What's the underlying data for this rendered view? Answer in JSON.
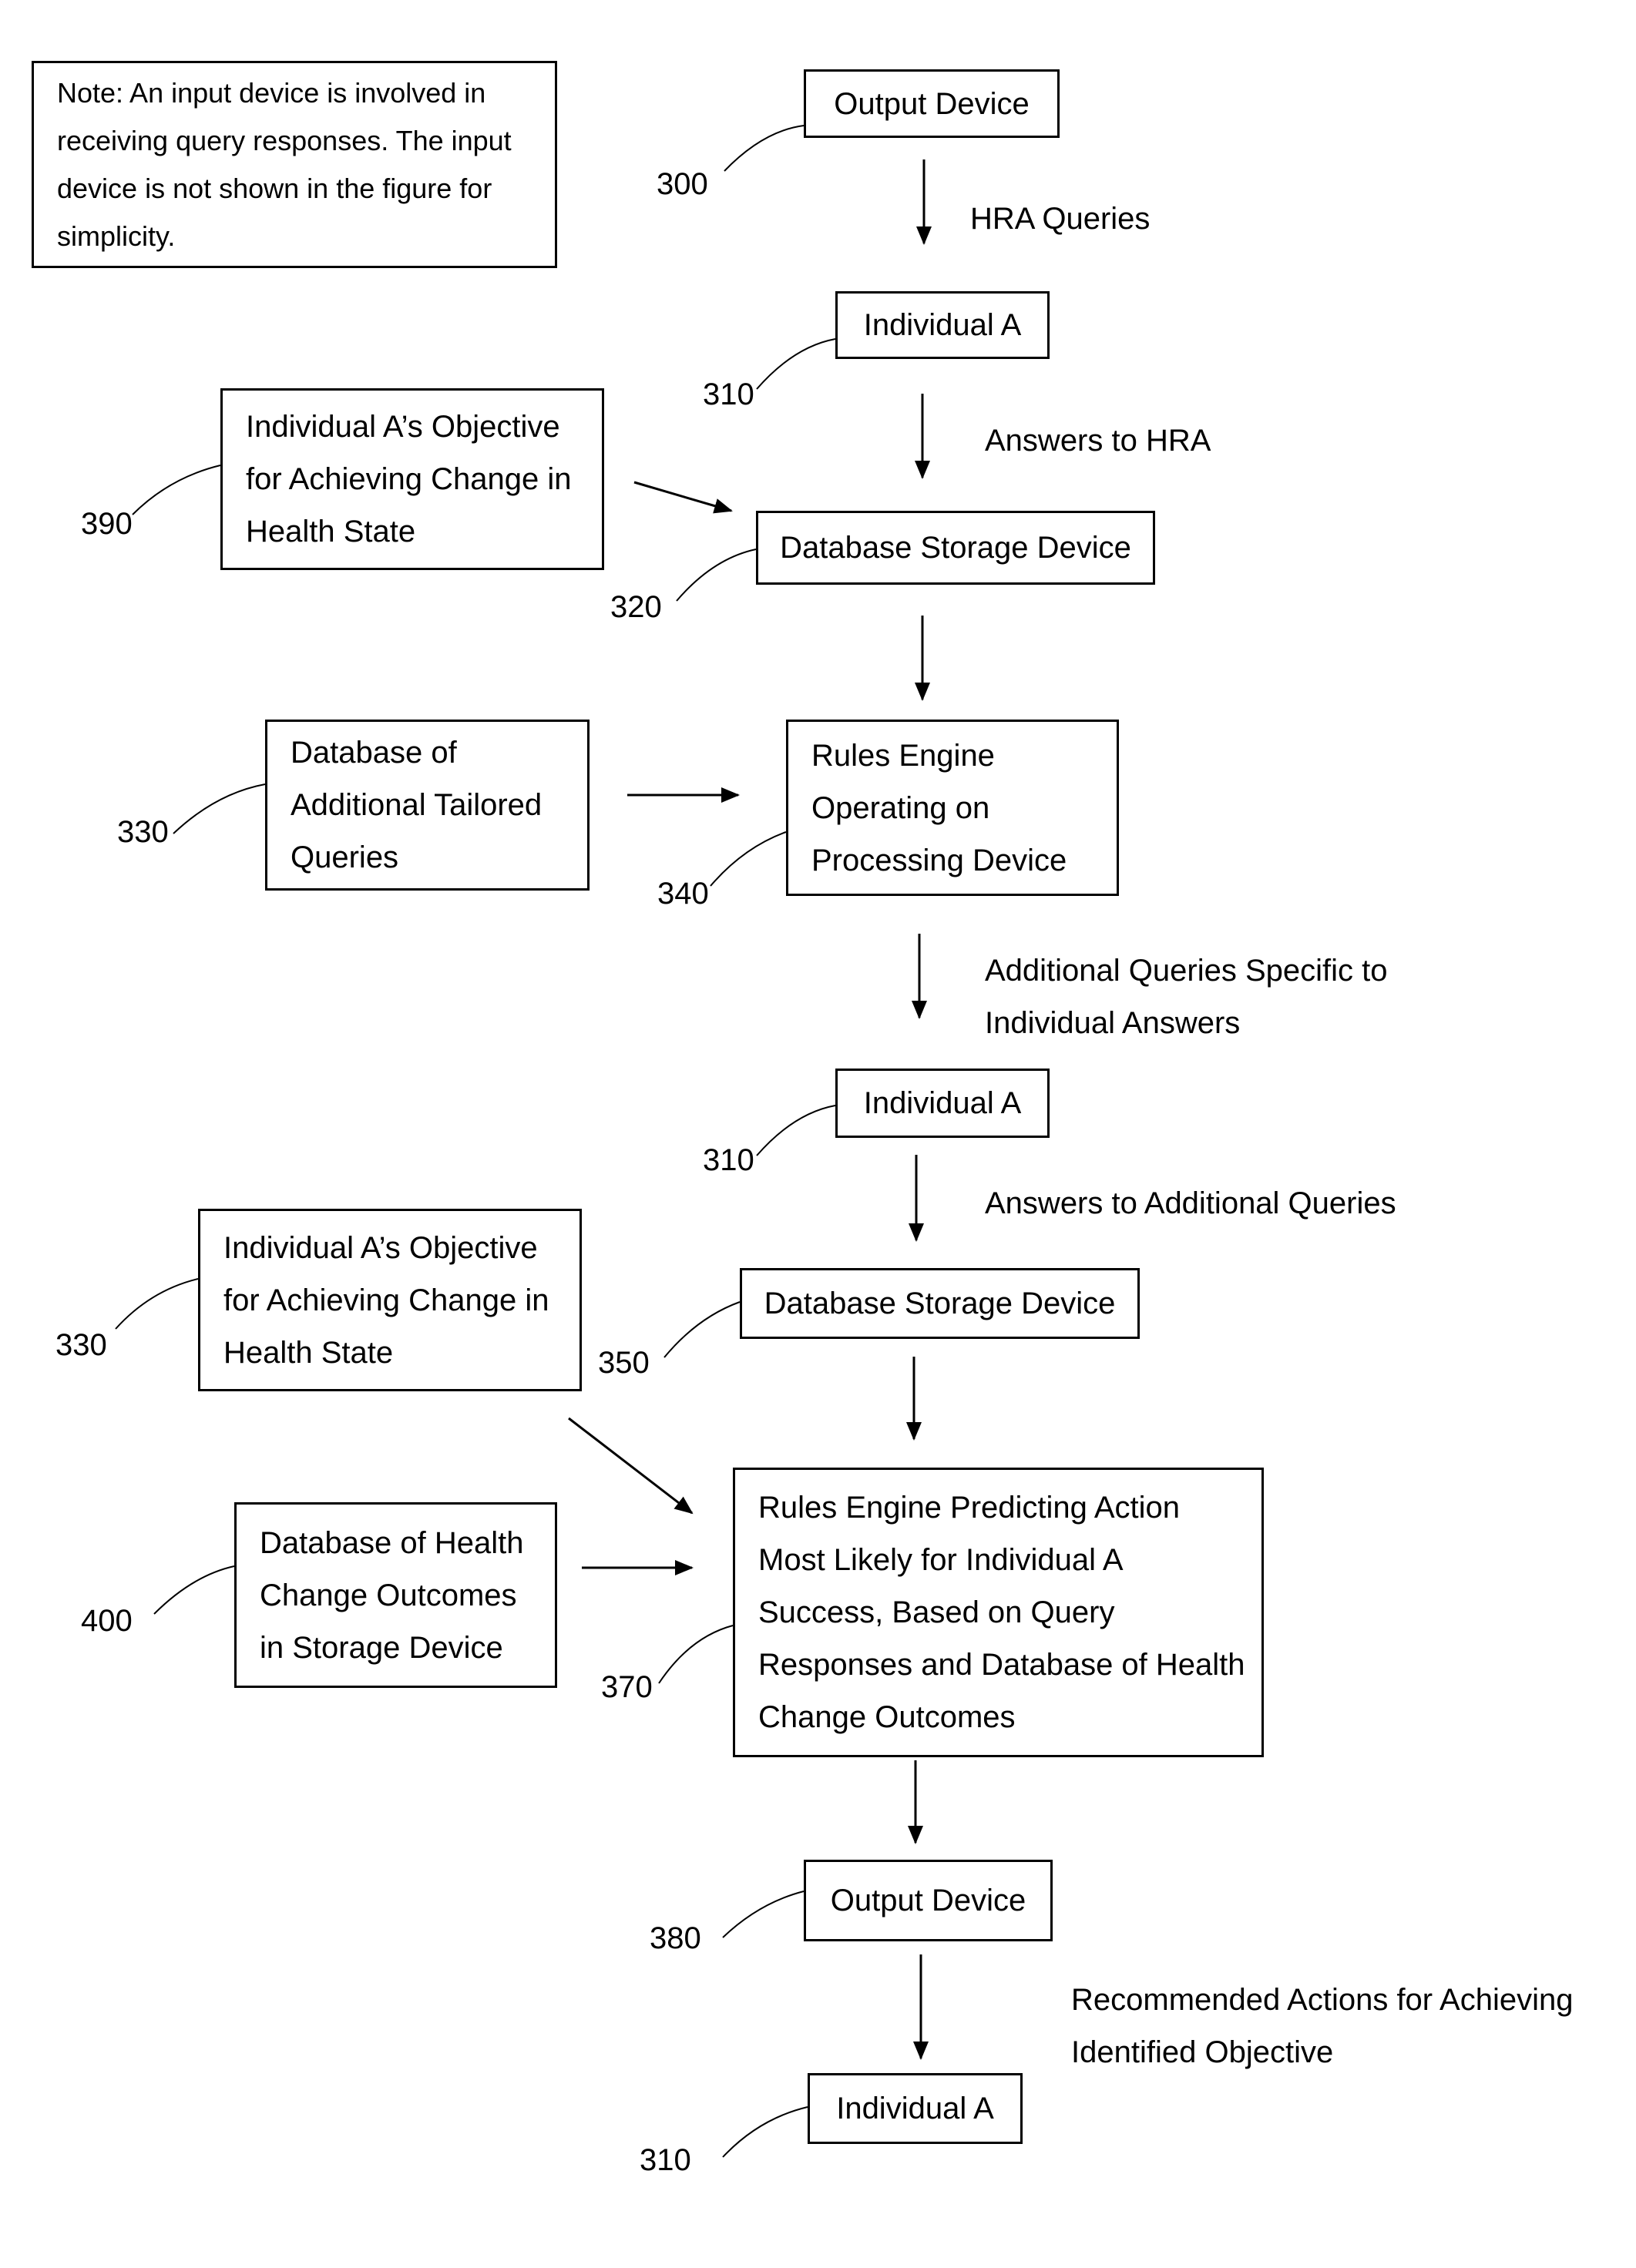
{
  "note": {
    "lines": [
      "Note: An input device is involved in",
      "receiving query responses. The input",
      "device is not shown in the figure for",
      "simplicity."
    ]
  },
  "nodes": {
    "output_device_300": {
      "ref": "300",
      "lines": [
        "Output Device"
      ]
    },
    "individual_a_1": {
      "ref": "310",
      "lines": [
        "Individual A"
      ]
    },
    "objective_390": {
      "ref": "390",
      "lines": [
        "Individual A’s Objective",
        "for Achieving Change in",
        "Health State"
      ]
    },
    "db_storage_320": {
      "ref": "320",
      "lines": [
        "Database Storage Device"
      ]
    },
    "db_tailored_330": {
      "ref": "330",
      "lines": [
        "Database of",
        "Additional Tailored",
        "Queries"
      ]
    },
    "rules_engine_340": {
      "ref": "340",
      "lines": [
        "Rules Engine",
        "Operating on",
        "Processing Device"
      ]
    },
    "individual_a_2": {
      "ref": "310",
      "lines": [
        "Individual A"
      ]
    },
    "db_storage_350": {
      "ref": "350",
      "lines": [
        "Database Storage Device"
      ]
    },
    "objective_330": {
      "ref": "330",
      "lines": [
        "Individual A’s Objective",
        "for Achieving Change in",
        "Health State"
      ]
    },
    "db_outcomes_400": {
      "ref": "400",
      "lines": [
        "Database of Health",
        "Change Outcomes",
        "in Storage Device"
      ]
    },
    "rules_engine_370": {
      "ref": "370",
      "lines": [
        "Rules Engine Predicting Action",
        "Most Likely for Individual A",
        "Success, Based on Query",
        "Responses and Database of Health",
        "Change Outcomes"
      ]
    },
    "output_device_380": {
      "ref": "380",
      "lines": [
        "Output Device"
      ]
    },
    "individual_a_3": {
      "ref": "310",
      "lines": [
        "Individual A"
      ]
    }
  },
  "edges": {
    "hra_queries": {
      "lines": [
        "HRA Queries"
      ]
    },
    "answers_to_hra": {
      "lines": [
        "Answers to HRA"
      ]
    },
    "additional_queries": {
      "lines": [
        "Additional Queries Specific to",
        "Individual Answers"
      ]
    },
    "answers_to_additional": {
      "lines": [
        "Answers to Additional Queries"
      ]
    },
    "recommended_actions": {
      "lines": [
        "Recommended Actions for Achieving",
        "Identified Objective"
      ]
    }
  }
}
